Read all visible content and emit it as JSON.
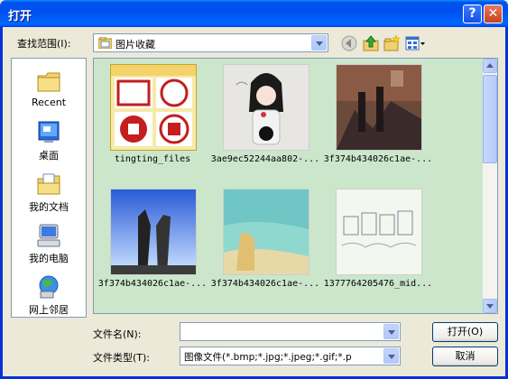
{
  "window": {
    "title": "打开"
  },
  "titlebar": {
    "help_glyph": "?",
    "close_glyph": "✕"
  },
  "lookin": {
    "label": "查找范围(I):",
    "value": "图片收藏"
  },
  "toolbar": {
    "icons": [
      "back-icon",
      "up-folder-icon",
      "new-folder-icon",
      "views-menu-icon"
    ]
  },
  "places": [
    {
      "label": "Recent",
      "icon": "recent-folder-icon"
    },
    {
      "label": "桌面",
      "icon": "desktop-icon"
    },
    {
      "label": "我的文档",
      "icon": "my-documents-icon"
    },
    {
      "label": "我的电脑",
      "icon": "my-computer-icon"
    },
    {
      "label": "网上邻居",
      "icon": "network-icon"
    }
  ],
  "files": [
    {
      "name": "tingting_files",
      "kind": "folder"
    },
    {
      "name": "3ae9ec52244aa802-...",
      "kind": "image"
    },
    {
      "name": "3f374b434026c1ae-...",
      "kind": "image"
    },
    {
      "name": "3f374b434026c1ae-...",
      "kind": "image"
    },
    {
      "name": "3f374b434026c1ae-...",
      "kind": "image"
    },
    {
      "name": "1377764205476_mid...",
      "kind": "image"
    }
  ],
  "filename": {
    "label": "文件名(N):",
    "value": ""
  },
  "filetype": {
    "label": "文件类型(T):",
    "value": "图像文件(*.bmp;*.jpg;*.jpeg;*.gif;*.p"
  },
  "buttons": {
    "open": "打开(O)",
    "cancel": "取消"
  },
  "colors": {
    "title_blue": "#0053ee",
    "list_bg": "#cce6cc",
    "client_bg": "#ece9d8"
  }
}
